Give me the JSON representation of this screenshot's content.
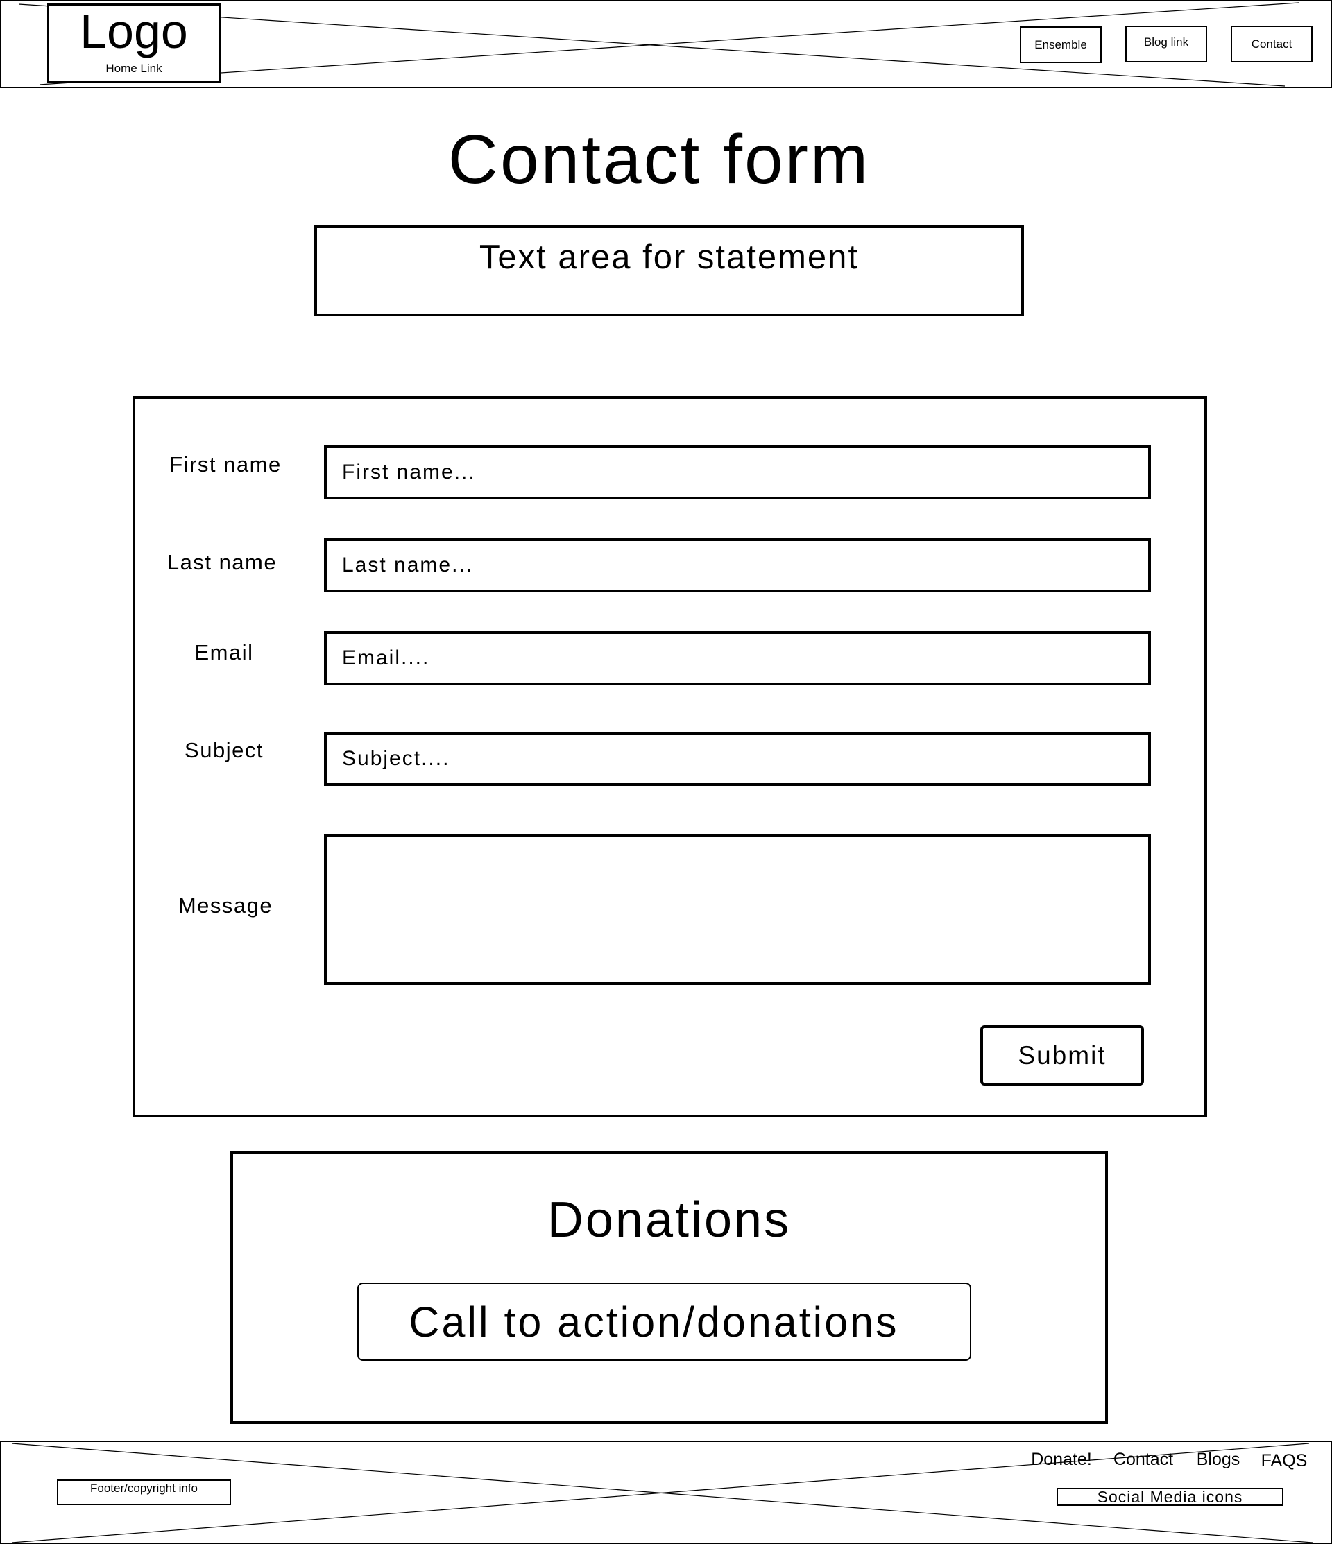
{
  "header": {
    "logo": "Logo",
    "home_link": "Home Link",
    "nav": [
      "Ensemble",
      "Blog link",
      "Contact"
    ]
  },
  "page": {
    "title": "Contact form",
    "statement": "Text area for statement"
  },
  "form": {
    "fields": [
      {
        "label": "First name",
        "placeholder": "First name..."
      },
      {
        "label": "Last name",
        "placeholder": "Last name..."
      },
      {
        "label": "Email",
        "placeholder": "Email...."
      },
      {
        "label": "Subject",
        "placeholder": "Subject...."
      }
    ],
    "message_label": "Message",
    "submit": "Submit"
  },
  "donations": {
    "title": "Donations",
    "cta": "Call to action/donations"
  },
  "footer": {
    "copyright": "Footer/copyright info",
    "links": [
      "Donate!",
      "Contact",
      "Blogs",
      "FAQS"
    ],
    "social": "Social Media icons"
  }
}
